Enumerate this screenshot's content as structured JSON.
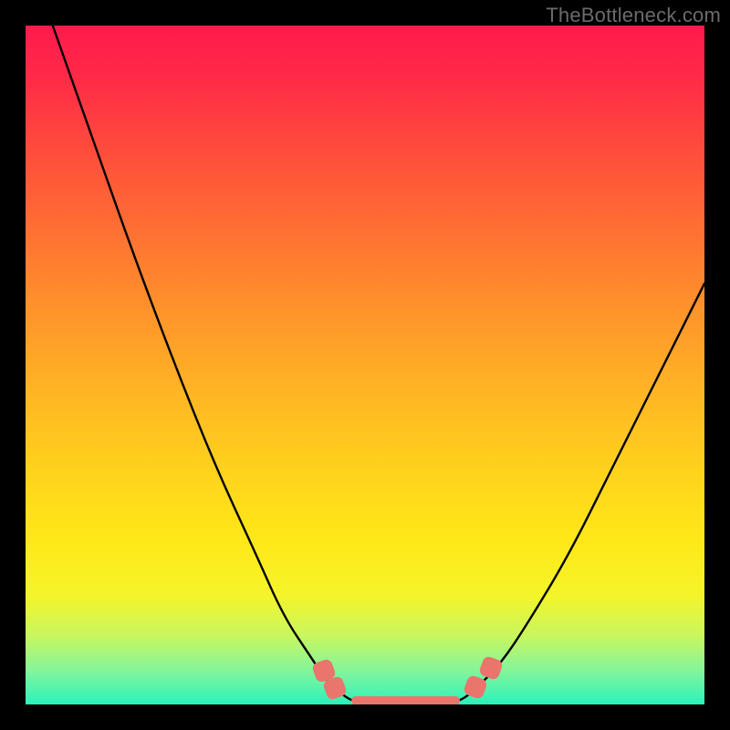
{
  "watermark": "TheBottleneck.com",
  "colors": {
    "frame": "#000000",
    "curve": "#000000",
    "marker": "#e9756c",
    "gradient_top": "#ff1a4d",
    "gradient_bottom": "#2bf2bb"
  },
  "chart_data": {
    "type": "line",
    "title": "",
    "xlabel": "",
    "ylabel": "",
    "xlim": [
      0,
      100
    ],
    "ylim": [
      0,
      100
    ],
    "grid": false,
    "legend": false,
    "series": [
      {
        "name": "left-branch",
        "x": [
          4,
          10,
          16,
          22,
          28,
          34,
          38,
          42,
          44,
          46,
          48
        ],
        "y": [
          100,
          83,
          66,
          50,
          35,
          22,
          13,
          7,
          4,
          2,
          0.5
        ]
      },
      {
        "name": "floor",
        "x": [
          48,
          50,
          54,
          58,
          62,
          64
        ],
        "y": [
          0.5,
          0.3,
          0.2,
          0.2,
          0.3,
          0.5
        ]
      },
      {
        "name": "right-branch",
        "x": [
          64,
          66,
          70,
          74,
          80,
          86,
          92,
          100
        ],
        "y": [
          0.5,
          2,
          6,
          12,
          22,
          34,
          46,
          62
        ]
      }
    ],
    "markers": [
      {
        "x": 44.0,
        "y": 5.0,
        "variant": "tilt-l"
      },
      {
        "x": 45.6,
        "y": 2.4,
        "variant": "tilt-l"
      },
      {
        "x": 66.3,
        "y": 2.6,
        "variant": "tilt-r"
      },
      {
        "x": 68.6,
        "y": 5.4,
        "variant": "tilt-r"
      }
    ],
    "floor_bar": {
      "x0": 48,
      "x1": 64,
      "y": 0.6
    },
    "note": "Axis values are normalized 0–100 in plot coordinates; no numeric tick labels are shown in the source image."
  }
}
